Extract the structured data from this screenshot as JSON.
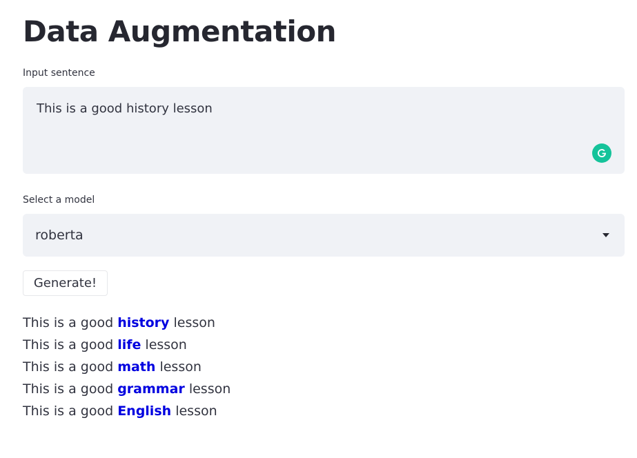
{
  "page": {
    "title": "Data Augmentation"
  },
  "input": {
    "label": "Input sentence",
    "value": "This is a good history lesson"
  },
  "grammarly": {
    "icon": "grammarly-g-icon",
    "letter": "G",
    "color": "#15c39a"
  },
  "model_select": {
    "label": "Select a model",
    "selected": "roberta",
    "icon": "chevron-down-icon"
  },
  "generate_button": {
    "label": "Generate!"
  },
  "results": [
    {
      "before": "This is a good ",
      "word": "history",
      "after": " lesson"
    },
    {
      "before": "This is a good ",
      "word": "life",
      "after": " lesson"
    },
    {
      "before": "This is a good ",
      "word": "math",
      "after": " lesson"
    },
    {
      "before": "This is a good ",
      "word": "grammar",
      "after": " lesson"
    },
    {
      "before": "This is a good ",
      "word": "English",
      "after": " lesson"
    }
  ],
  "colors": {
    "highlight": "#0000e0",
    "input_background": "#f0f2f6",
    "text": "#31333f"
  }
}
